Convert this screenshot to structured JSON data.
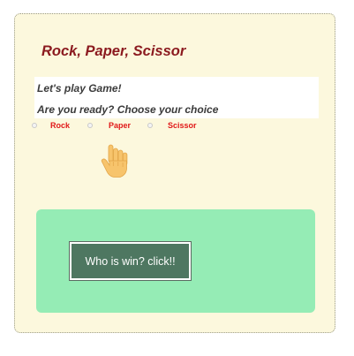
{
  "title": "Rock, Paper, Scissor",
  "prompt": {
    "line1": "Let's play Game!",
    "line2": "Are you ready? Choose your choice"
  },
  "choices": [
    {
      "label": "Rock",
      "selected": false
    },
    {
      "label": "Paper",
      "selected": false
    },
    {
      "label": "Scissor",
      "selected": false
    }
  ],
  "cursor": {
    "icon": "hand-pointer-icon"
  },
  "result": {
    "button_label": "Who is win? click!!"
  },
  "colors": {
    "card_background": "#fcf8dd",
    "title": "#8b1a1f",
    "choice_label": "#e01818",
    "result_panel": "#95ecb5",
    "button": "#4e7761"
  }
}
